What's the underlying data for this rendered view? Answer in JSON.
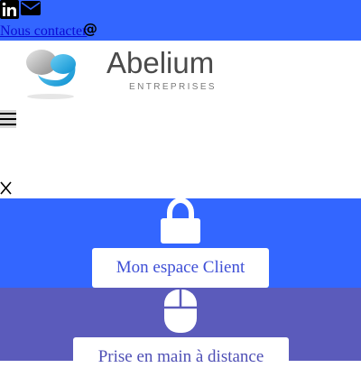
{
  "topbar": {
    "social_icons": [
      "linkedin-icon",
      "envelope-icon"
    ],
    "contact_label": "Nous contacter",
    "at_symbol": "@"
  },
  "brand": {
    "name": "Abelium",
    "tagline": "ENTREPRISES"
  },
  "nav": {
    "menu_icon": "hamburger-menu-icon",
    "close_icon": "close-icon"
  },
  "actions": [
    {
      "label": "Mon espace Client",
      "icon": "lock-icon"
    },
    {
      "label": "Prise en main à distance",
      "icon": "mouse-icon"
    }
  ],
  "colors": {
    "accent_blue": "#3366ff",
    "accent_purple": "#5b5bbb",
    "button_text": "#3e4fd6"
  }
}
